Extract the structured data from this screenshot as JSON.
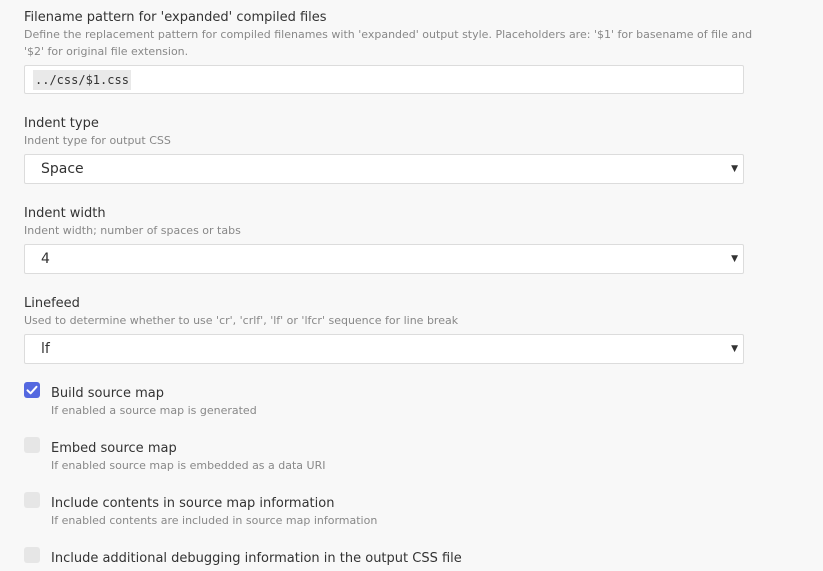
{
  "filename_pattern": {
    "title": "Filename pattern for 'expanded' compiled files",
    "description": "Define the replacement pattern for compiled filenames with 'expanded' output style. Placeholders are: '$1' for basename of file and '$2' for original file extension.",
    "value": "../css/$1.css"
  },
  "indent_type": {
    "title": "Indent type",
    "description": "Indent type for output CSS",
    "selected": "Space"
  },
  "indent_width": {
    "title": "Indent width",
    "description": "Indent width; number of spaces or tabs",
    "selected": "4"
  },
  "linefeed": {
    "title": "Linefeed",
    "description": "Used to determine whether to use 'cr', 'crlf', 'lf' or 'lfcr' sequence for line break",
    "selected": "lf"
  },
  "checkboxes": [
    {
      "label": "Build source map",
      "description": "If enabled a source map is generated",
      "checked": true
    },
    {
      "label": "Embed source map",
      "description": "If enabled source map is embedded as a data URI",
      "checked": false
    },
    {
      "label": "Include contents in source map information",
      "description": "If enabled contents are included in source map information",
      "checked": false
    },
    {
      "label": "Include additional debugging information in the output CSS file",
      "description": "",
      "checked": false
    }
  ],
  "icons": {
    "dropdown": "chevron-down-icon",
    "check": "checkmark-icon"
  },
  "colors": {
    "checkbox_checked": "#5468e0",
    "checkbox_unchecked": "#e6e6e6"
  }
}
